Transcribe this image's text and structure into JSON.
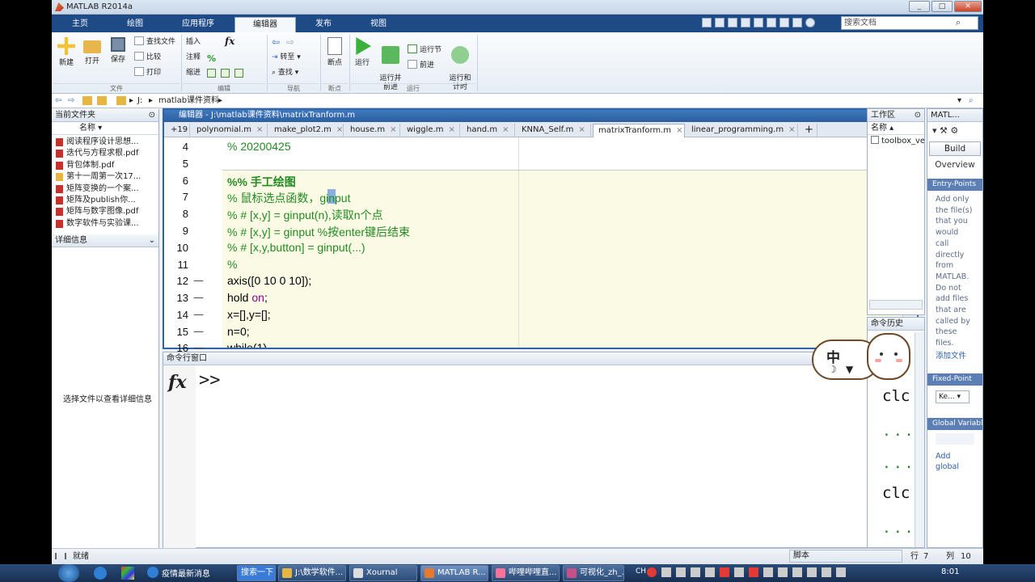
{
  "window": {
    "title": "MATLAB R2014a",
    "min": "_",
    "max": "□",
    "close": "✕"
  },
  "ribbon_tabs": [
    "主页",
    "绘图",
    "应用程序",
    "编辑器",
    "发布",
    "视图"
  ],
  "search_placeholder": "搜索文档",
  "ribbon": {
    "file": {
      "new": "新建",
      "open": "打开",
      "save": "保存",
      "find_files": "查找文件",
      "compare": "比较",
      "print": "打印",
      "label": "文件"
    },
    "edit": {
      "insert": "插入",
      "comment": "注释",
      "indent": "缩进",
      "label": "编辑",
      "fx": "fx"
    },
    "nav": {
      "goto": "转至",
      "find": "查找",
      "label": "导航"
    },
    "bp": {
      "breakpoints": "断点",
      "label": "断点"
    },
    "run": {
      "run": "运行",
      "run_advance": "运行并\n前进",
      "run_section": "运行节",
      "advance": "前进",
      "run_time": "运行和\n计时",
      "label": "运行"
    }
  },
  "address": {
    "drive": "J:",
    "folder": "matlab课件资料"
  },
  "left_panel": {
    "header": "当前文件夹",
    "col_name": "名称",
    "files": [
      {
        "name": "阅读程序设计思想...",
        "type": "pdf"
      },
      {
        "name": "迭代与方程求根.pdf",
        "type": "pdf"
      },
      {
        "name": "背包体制.pdf",
        "type": "pdf"
      },
      {
        "name": "第十一周第一次17...",
        "type": "folder"
      },
      {
        "name": "矩阵变换的一个案...",
        "type": "pdf"
      },
      {
        "name": "矩阵及publish你...",
        "type": "pdf"
      },
      {
        "name": "矩阵与数字图像.pdf",
        "type": "pdf"
      },
      {
        "name": "数字软件与实验课...",
        "type": "pdf"
      }
    ],
    "details_header": "详细信息",
    "details_hint": "选择文件以查看详细信息"
  },
  "editor": {
    "title": "编辑器 - J:\\matlab课件资料\\matrixTranform.m",
    "tab_count": "+19",
    "tabs": [
      "polynomial.m",
      "make_plot2.m",
      "house.m",
      "wiggle.m",
      "hand.m",
      "KNNA_Self.m",
      "matrixTranform.m",
      "linear_programming.m"
    ],
    "active_tab": 6,
    "lines": [
      {
        "n": "4",
        "dash": "",
        "text": "% 20200425",
        "cls": "cm"
      },
      {
        "n": "5",
        "dash": "",
        "text": "",
        "cls": ""
      },
      {
        "n": "6",
        "dash": "",
        "text": "%% 手工绘图",
        "cls": "cm bold"
      },
      {
        "n": "7",
        "dash": "",
        "text": "% 鼠标选点函数，ginput",
        "cls": "cm"
      },
      {
        "n": "8",
        "dash": "",
        "text": "% # [x,y] = ginput(n),读取n个点",
        "cls": "cm"
      },
      {
        "n": "9",
        "dash": "",
        "text": "% # [x,y] = ginput %按enter键后结束",
        "cls": "cm"
      },
      {
        "n": "10",
        "dash": "",
        "text": "% # [x,y,button] = ginput(...)",
        "cls": "cm"
      },
      {
        "n": "11",
        "dash": "",
        "text": "%",
        "cls": "cm"
      },
      {
        "n": "12",
        "dash": "—",
        "text": "axis([0 10 0 10]);",
        "cls": ""
      },
      {
        "n": "13",
        "dash": "—",
        "text": "hold on;",
        "cls": ""
      },
      {
        "n": "14",
        "dash": "—",
        "text": "x=[],y=[];",
        "cls": ""
      },
      {
        "n": "15",
        "dash": "—",
        "text": "n=0;",
        "cls": ""
      },
      {
        "n": "16",
        "dash": "—",
        "text": "while(1)",
        "cls": ""
      }
    ]
  },
  "command_window": {
    "header": "命令行窗口",
    "fx": "fx",
    "prompt": ">>"
  },
  "workspace": {
    "header": "工作区",
    "col_name": "名称",
    "item": "toolbox_ver"
  },
  "history": {
    "header": "命令历史",
    "entries": [
      "clc",
      "...",
      "...",
      "clc",
      "..."
    ]
  },
  "mbuilder": {
    "header": "MATL...",
    "build": "Build",
    "overview": "Overview",
    "entry_header": "Entry-Points",
    "entry_text": [
      "Add only",
      "the file(s)",
      "that you",
      "would",
      "call",
      "directly",
      "from",
      "MATLAB.",
      "Do not",
      "add files",
      "that are",
      "called by",
      "these",
      "files."
    ],
    "add_file": "添加文件",
    "fixed_header": "Fixed-Point",
    "fixed_select": "Ke...",
    "global_header": "Global Variables",
    "global_text": [
      "Add",
      "global"
    ]
  },
  "statusbar": {
    "ready": "就绪",
    "mode": "脚本",
    "row_label": "行",
    "row": "7",
    "col_label": "列",
    "col": "10"
  },
  "taskbar": {
    "items": [
      "疫情最新消息",
      "搜索一下",
      "J:\\数学软件...",
      "Xournal",
      "MATLAB R...",
      "哔哩哔哩直...",
      "可视化_zh_..."
    ],
    "time": "8:01",
    "lang": "CH"
  },
  "sticker": {
    "text": "中"
  }
}
